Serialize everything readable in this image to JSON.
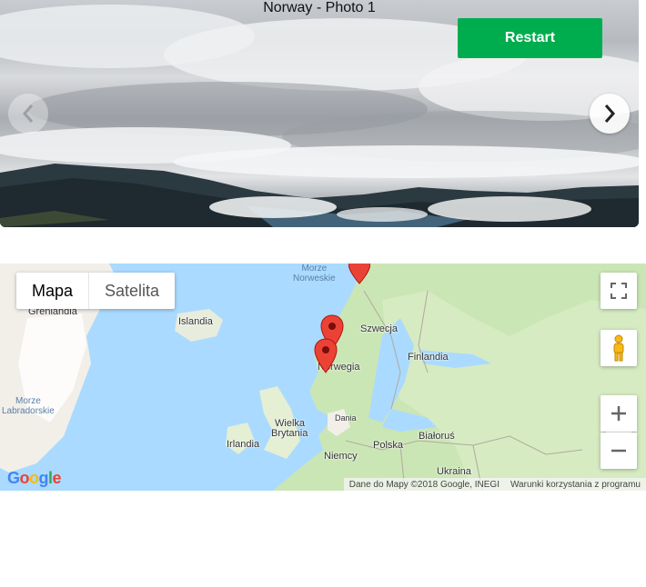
{
  "carousel": {
    "title": "Norway - Photo 1",
    "restart_label": "Restart",
    "prev_icon": "chevron-left-icon",
    "next_icon": "chevron-right-icon"
  },
  "map": {
    "map_type": {
      "map_label": "Mapa",
      "satellite_label": "Satelita",
      "selected": "Mapa"
    },
    "labels": {
      "greenland": "Grenlandia",
      "iceland": "Islandia",
      "sweden": "Szwecja",
      "finland": "Finlandia",
      "norway": "Norwegia",
      "uk": "Wielka",
      "uk2": "Brytania",
      "ireland": "Irlandia",
      "denmark": "Dania",
      "poland": "Polska",
      "belarus": "Białoruś",
      "germany": "Niemcy",
      "ukraine": "Ukraina",
      "norwegian_sea_1": "Morze",
      "norwegian_sea_2": "Norweskie",
      "labrador_sea_1": "Morze",
      "labrador_sea_2": "Labradorskie"
    },
    "attribution": "Dane do Mapy ©2018 Google, INEGI",
    "terms": "Warunki korzystania z programu",
    "logo": "Google",
    "colors": {
      "water": "#aadaff",
      "land": "#f2efe9",
      "green": "#cbe6b5",
      "marker": "#ea4335",
      "restart": "#00ad4e"
    },
    "markers": [
      "marker-north",
      "marker-bergen-1",
      "marker-bergen-2"
    ]
  }
}
